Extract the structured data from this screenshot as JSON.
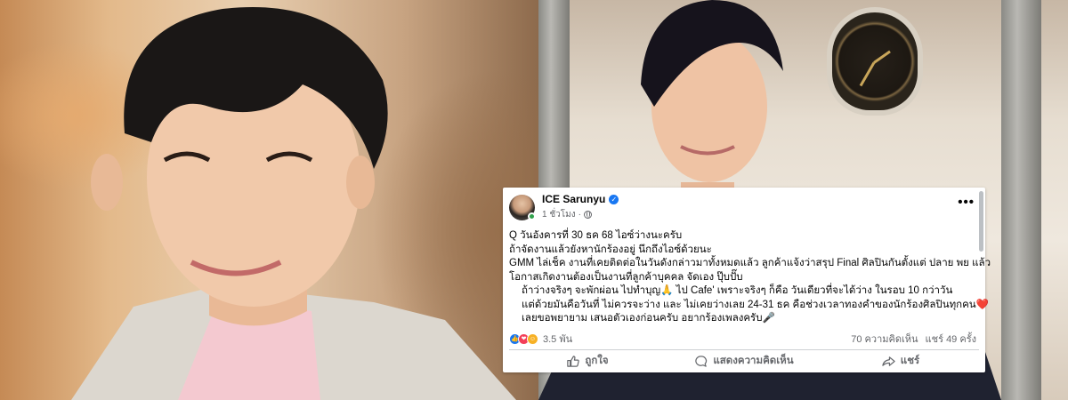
{
  "post": {
    "author": "ICE Sarunyu",
    "time": "1 ชั่วโมง",
    "more_glyph": "•••",
    "verified_glyph": "✓",
    "lines": [
      "Q วันอังคารที่ 30 ธค 68 ไอซ์ว่างนะครับ",
      "ถ้าจัดงานแล้วยังหานักร้องอยู่ นึกถึงไอซ์ด้วยนะ",
      "GMM ไล่เช็ค งานที่เคยติดต่อในวันดังกล่าวมาทั้งหมดแล้ว ลูกค้าแจ้งว่าสรุป Final ศิลปินกันตั้งแต่ ปลาย พย แล้ว",
      "โอกาสเกิดงานต้องเป็นงานที่ลูกค้าบุคคล จัดเอง ปุ๊บปั๊บ",
      "ถ้าว่างจริงๆ จะพักผ่อน ไปทำบุญ🙏 ไป Cafe' เพราะจริงๆ ก็คือ วันเดียวที่จะได้ว่าง ในรอบ 10 กว่าวัน",
      "แต่ด้วยมันคือวันที่ ไม่ควรจะว่าง และ ไม่เคยว่างเลย 24-31 ธค คือช่วงเวลาทองคำของนักร้องศิลปินทุกคน❤️",
      "เลยขอพยายาม เสนอตัวเองก่อนครับ อยากร้องเพลงครับ🎤"
    ],
    "reaction_count": "3.5 พัน",
    "comments": "70 ความคิดเห็น",
    "shares": "แชร์ 49 ครั้ง",
    "actions": {
      "like": "ถูกใจ",
      "comment": "แสดงความคิดเห็น",
      "share": "แชร์"
    },
    "reaction_icons": [
      "like-icon",
      "love-icon",
      "care-icon"
    ],
    "colors": {
      "facebook_blue": "#1877f2",
      "love_red": "#f33e58",
      "care_yellow": "#f7b125",
      "online_green": "#31a24c"
    }
  }
}
